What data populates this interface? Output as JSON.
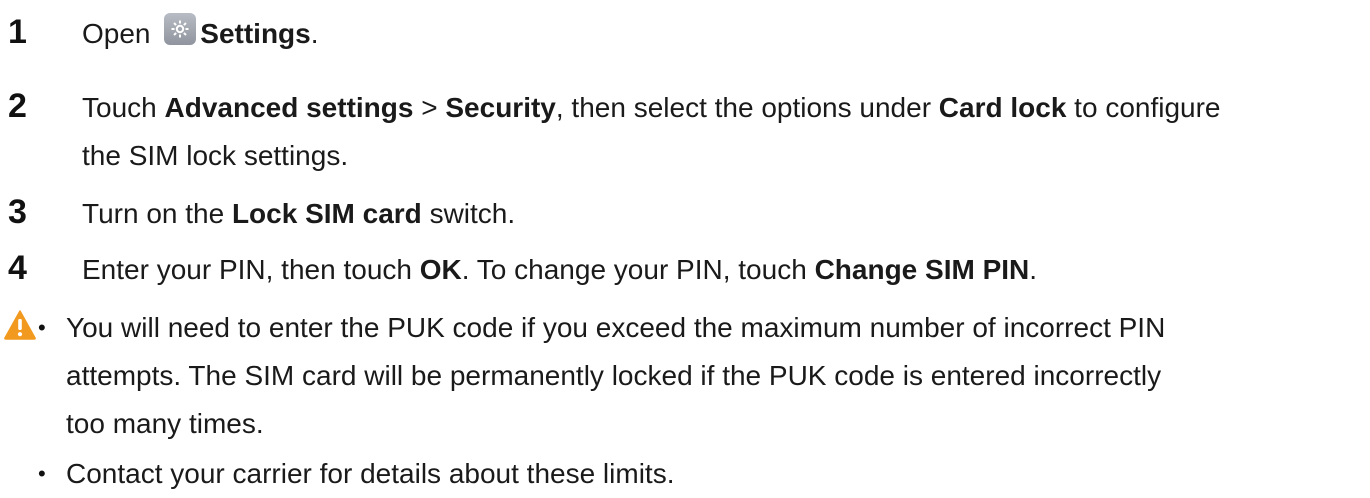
{
  "steps": [
    {
      "number": "1",
      "parts": [
        "Open ",
        "Settings",
        "."
      ]
    },
    {
      "number": "2",
      "parts": [
        "Touch ",
        "Advanced settings",
        " > ",
        "Security",
        ", then select the options under ",
        "Card lock",
        " to configure",
        "the SIM lock settings."
      ]
    },
    {
      "number": "3",
      "parts": [
        "Turn on the ",
        "Lock SIM card",
        " switch."
      ]
    },
    {
      "number": "4",
      "parts": [
        "Enter your PIN, then touch ",
        "OK",
        ". To change your PIN, touch ",
        "Change SIM PIN",
        "."
      ]
    }
  ],
  "notes": {
    "bullet_glyph": "•",
    "items": [
      {
        "lines": [
          "You will need to enter the PUK code if you exceed the maximum number of incorrect PIN",
          "attempts. The SIM card will be permanently locked if the PUK code is entered incorrectly",
          "too many times."
        ]
      },
      {
        "lines": [
          "Contact your carrier for details about these limits."
        ]
      }
    ]
  },
  "icons": {
    "settings": "gear-icon",
    "warning": "warning-icon"
  },
  "colors": {
    "warning": "#f29a1f",
    "text": "#1a1a1a"
  }
}
